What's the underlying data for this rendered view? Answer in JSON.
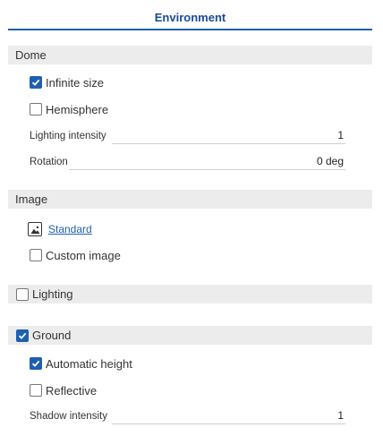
{
  "panel": {
    "title": "Environment"
  },
  "dome": {
    "header": "Dome",
    "infinite_size": {
      "label": "Infinite size",
      "checked": true
    },
    "hemisphere": {
      "label": "Hemisphere",
      "checked": false
    },
    "lighting_intensity": {
      "label": "Lighting intensity",
      "value": "1"
    },
    "rotation": {
      "label": "Rotation",
      "value": "0 deg"
    }
  },
  "image": {
    "header": "Image",
    "standard_label": "Standard",
    "icon": "image-icon",
    "custom_image": {
      "label": "Custom image",
      "checked": false
    }
  },
  "lighting": {
    "label": "Lighting",
    "checked": false
  },
  "ground": {
    "label": "Ground",
    "checked": true,
    "automatic_height": {
      "label": "Automatic height",
      "checked": true
    },
    "reflective": {
      "label": "Reflective",
      "checked": false
    },
    "shadow_intensity": {
      "label": "Shadow intensity",
      "value": "1"
    }
  },
  "colors": {
    "accent": "#1f5fb0",
    "section_bg": "#ececec"
  }
}
